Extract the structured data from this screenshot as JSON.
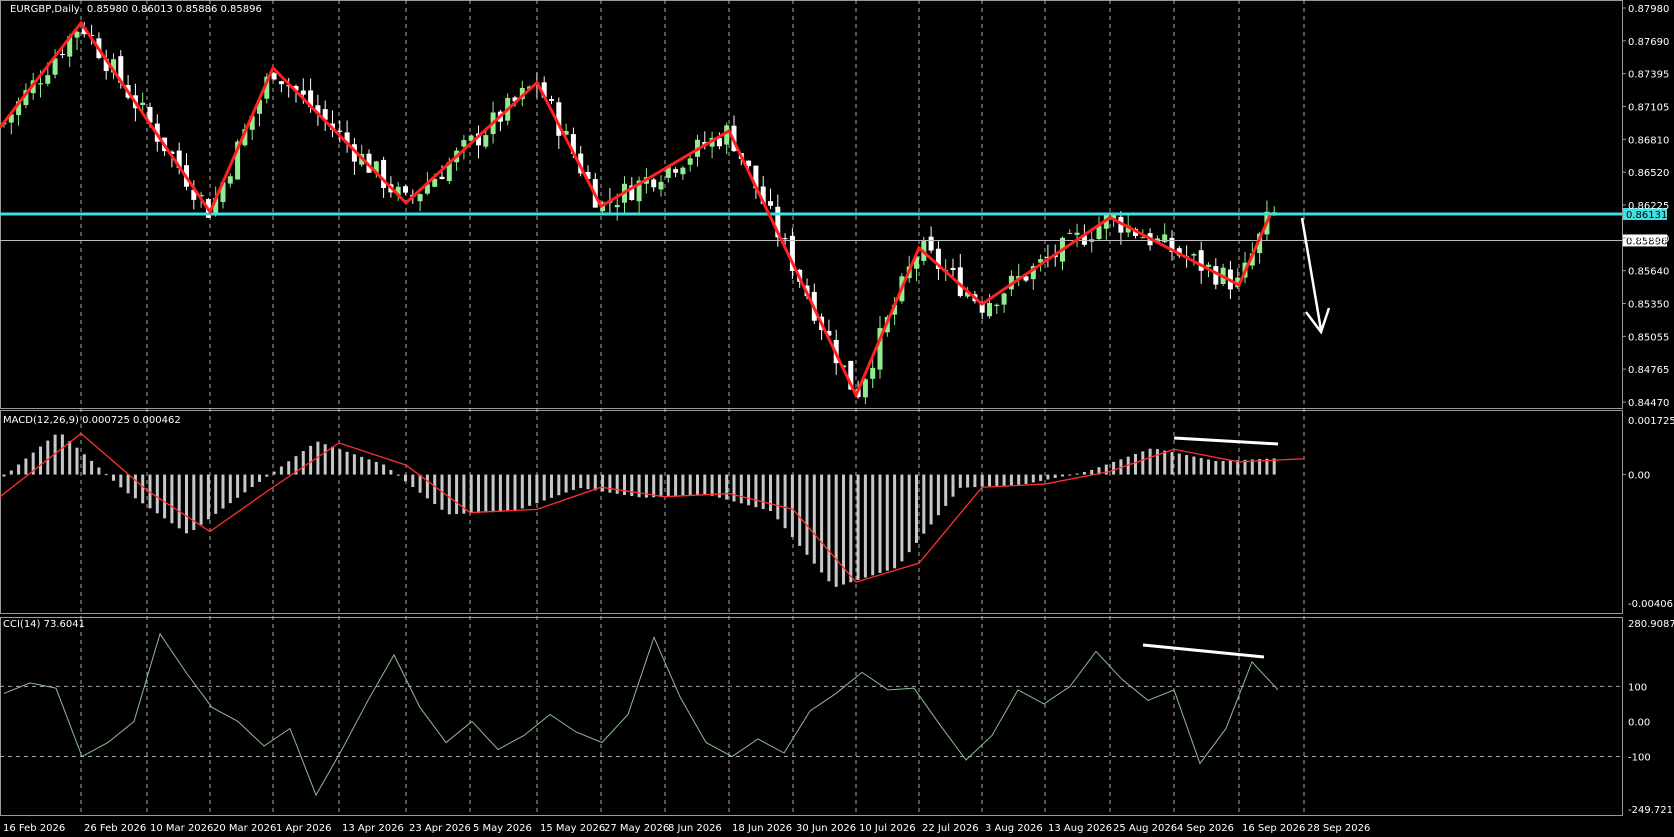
{
  "chart_data": {
    "type": "candlestick",
    "symbol_header": "EURGBP,Daily",
    "ohlc_header": "0.85980 0.86013 0.85886 0.85896",
    "colors": {
      "background": "#000000",
      "grid": "#c8c8c8",
      "bull": "#90ee90",
      "bear": "#ffffff",
      "zigzag": "#ff2020",
      "hline": "#40e0e0",
      "arrow": "#ffffff",
      "macd_hist": "#c8c8c8",
      "macd_signal": "#ff3030",
      "cci_line": "#8fbc8f"
    },
    "price_axis_ticks": [
      "0.87980",
      "0.87690",
      "0.87395",
      "0.87105",
      "0.86810",
      "0.86520",
      "0.86225",
      "0.85930",
      "0.85640",
      "0.85350",
      "0.85055",
      "0.84765",
      "0.84470"
    ],
    "price_markers": {
      "resistance": "0.86131",
      "current": "0.85896"
    },
    "ylim": [
      0.8446,
      0.8798
    ],
    "date_labels": [
      "16 Feb 2026",
      "26 Feb 2026",
      "10 Mar 2026",
      "20 Mar 2026",
      "1 Apr 2026",
      "13 Apr 2026",
      "23 Apr 2026",
      "5 May 2026",
      "15 May 2026",
      "27 May 2026",
      "8 Jun 2026",
      "18 Jun 2026",
      "30 Jun 2026",
      "10 Jul 2026",
      "22 Jul 2026",
      "3 Aug 2026",
      "13 Aug 2026",
      "25 Aug 2026",
      "4 Sep 2026",
      "16 Sep 2026",
      "28 Sep 2026"
    ],
    "zigzag_points": [
      {
        "date": "16 Feb 2026",
        "value": 0.869
      },
      {
        "date": "26 Feb 2026",
        "value": 0.8783
      },
      {
        "date": "20 Mar 2026",
        "value": 0.8615
      },
      {
        "date": "1 Apr 2026",
        "value": 0.8743
      },
      {
        "date": "23 Apr 2026",
        "value": 0.8623
      },
      {
        "date": "15 May 2026",
        "value": 0.873
      },
      {
        "date": "27 May 2026",
        "value": 0.862
      },
      {
        "date": "18 Jun 2026",
        "value": 0.8687
      },
      {
        "date": "10 Jul 2026",
        "value": 0.8452
      },
      {
        "date": "22 Jul 2026",
        "value": 0.8583
      },
      {
        "date": "3 Aug 2026",
        "value": 0.8533
      },
      {
        "date": "25 Aug 2026",
        "value": 0.861
      },
      {
        "date": "16 Sep 2026",
        "value": 0.855
      },
      {
        "date": "25 Sep 2026",
        "value": 0.8612
      }
    ],
    "macd": {
      "label": "MACD(12,26,9) 0.000725 0.000462",
      "axis_ticks": [
        "0.001725",
        "0.00",
        "-0.00406"
      ],
      "ylim": [
        -0.00406,
        0.001725
      ],
      "signal_points": [
        {
          "date": "16 Feb 2026",
          "value": -0.0007
        },
        {
          "date": "26 Feb 2026",
          "value": 0.0013
        },
        {
          "date": "10 Mar 2026",
          "value": -0.0005
        },
        {
          "date": "20 Mar 2026",
          "value": -0.0018
        },
        {
          "date": "1 Apr 2026",
          "value": -0.0004
        },
        {
          "date": "13 Apr 2026",
          "value": 0.001
        },
        {
          "date": "23 Apr 2026",
          "value": 0.0003
        },
        {
          "date": "5 May 2026",
          "value": -0.0012
        },
        {
          "date": "15 May 2026",
          "value": -0.0011
        },
        {
          "date": "27 May 2026",
          "value": -0.0004
        },
        {
          "date": "8 Jun 2026",
          "value": -0.0007
        },
        {
          "date": "18 Jun 2026",
          "value": -0.0006
        },
        {
          "date": "30 Jun 2026",
          "value": -0.0011
        },
        {
          "date": "10 Jul 2026",
          "value": -0.0034
        },
        {
          "date": "22 Jul 2026",
          "value": -0.0028
        },
        {
          "date": "3 Aug 2026",
          "value": -0.0004
        },
        {
          "date": "13 Aug 2026",
          "value": -0.0003
        },
        {
          "date": "25 Aug 2026",
          "value": 0.0001
        },
        {
          "date": "4 Sep 2026",
          "value": 0.0008
        },
        {
          "date": "16 Sep 2026",
          "value": 0.0004
        },
        {
          "date": "28 Sep 2026",
          "value": 0.0005
        }
      ]
    },
    "cci": {
      "label": "CCI(14) 73.6041",
      "axis_ticks": [
        "280.9087",
        "100",
        "0.00",
        "-100",
        "-249.7217"
      ],
      "ylim": [
        -249.7217,
        280.9087
      ],
      "values": [
        80,
        110,
        95,
        -100,
        -60,
        0,
        250,
        140,
        40,
        0,
        -70,
        -20,
        -210,
        -80,
        60,
        190,
        40,
        -60,
        0,
        -80,
        -40,
        20,
        -30,
        -60,
        20,
        240,
        70,
        -60,
        -100,
        -50,
        -90,
        30,
        80,
        140,
        90,
        95,
        -10,
        -110,
        -40,
        90,
        50,
        100,
        200,
        120,
        60,
        90,
        -120,
        -20,
        170,
        90
      ],
      "divergence_label": ""
    }
  }
}
